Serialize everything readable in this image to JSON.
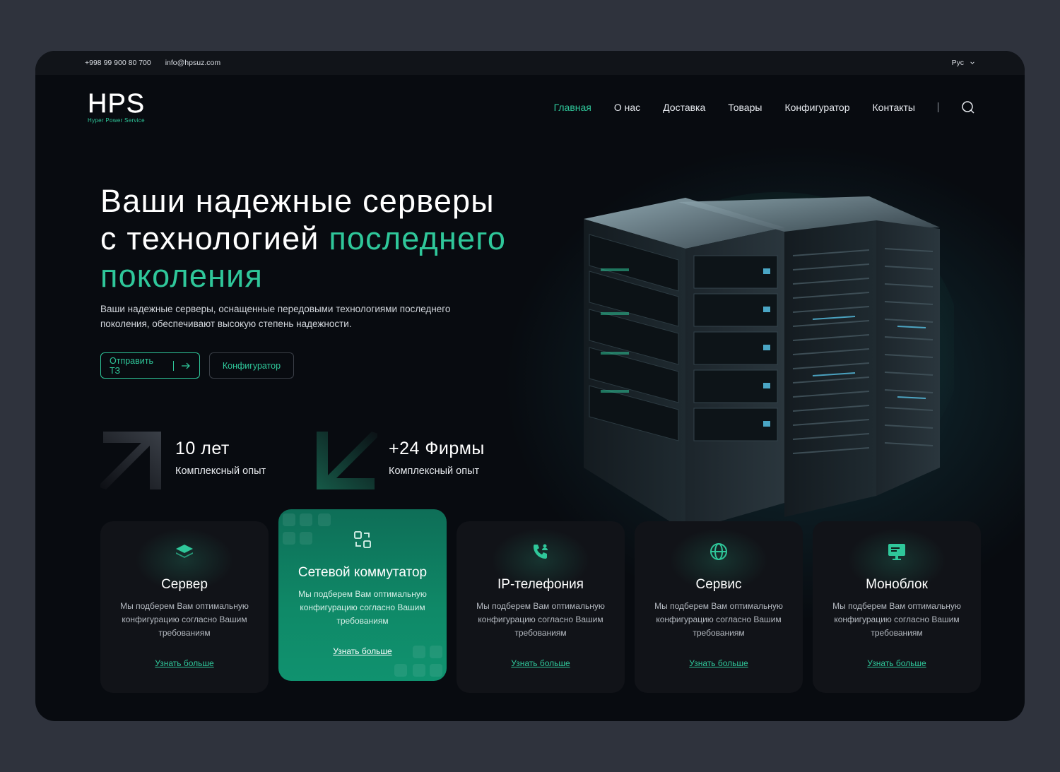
{
  "topbar": {
    "phone": "+998 99 900 80 700",
    "email": "info@hpsuz.com",
    "language": "Рус"
  },
  "brand": {
    "logo": "HPS",
    "tagline": "Hyper Power Service",
    "accent_color": "#2fc79a"
  },
  "nav": {
    "items": [
      {
        "label": "Главная",
        "active": true
      },
      {
        "label": "О нас"
      },
      {
        "label": "Доставка"
      },
      {
        "label": "Товары"
      },
      {
        "label": "Конфигуратор"
      },
      {
        "label": "Контакты"
      }
    ],
    "search_icon": "search-icon"
  },
  "hero": {
    "title_line1": "Ваши надежные серверы",
    "title_line2_plain": "с технологией ",
    "title_line2_accent": "последнего",
    "title_line3_accent": "поколения",
    "description": "Ваши надежные серверы, оснащенные передовыми технологиями последнего поколения, обеспечивают высокую степень надежности.",
    "button_send": "Отправить ТЗ",
    "button_configurator": "Конфигуратор"
  },
  "stats": [
    {
      "value": "10 лет",
      "label": "Комплексный опыт",
      "icon": "arrow-up-right-icon"
    },
    {
      "value": "+24 Фирмы",
      "label": "Комплексный опыт",
      "icon": "arrow-down-left-icon"
    }
  ],
  "cards": [
    {
      "title": "Сервер",
      "description": "Мы подберем Вам оптимальную конфигурацию согласно Вашим требованиям",
      "link": "Узнать больше",
      "icon": "layers-icon"
    },
    {
      "title": "Сетевой коммутатор",
      "description": "Мы подберем Вам оптимальную конфигурацию согласно Вашим требованиям",
      "link": "Узнать больше",
      "icon": "switch-icon",
      "active": true
    },
    {
      "title": "IP-телефония",
      "description": "Мы подберем Вам оптимальную конфигурацию согласно Вашим требованиям",
      "link": "Узнать больше",
      "icon": "phone-user-icon"
    },
    {
      "title": "Сервис",
      "description": "Мы подберем Вам оптимальную конфигурацию согласно Вашим требованиям",
      "link": "Узнать больше",
      "icon": "globe-icon"
    },
    {
      "title": "Моноблок",
      "description": "Мы подберем Вам оптимальную конфигурацию согласно Вашим требованиям",
      "link": "Узнать больше",
      "icon": "monitor-icon"
    }
  ]
}
